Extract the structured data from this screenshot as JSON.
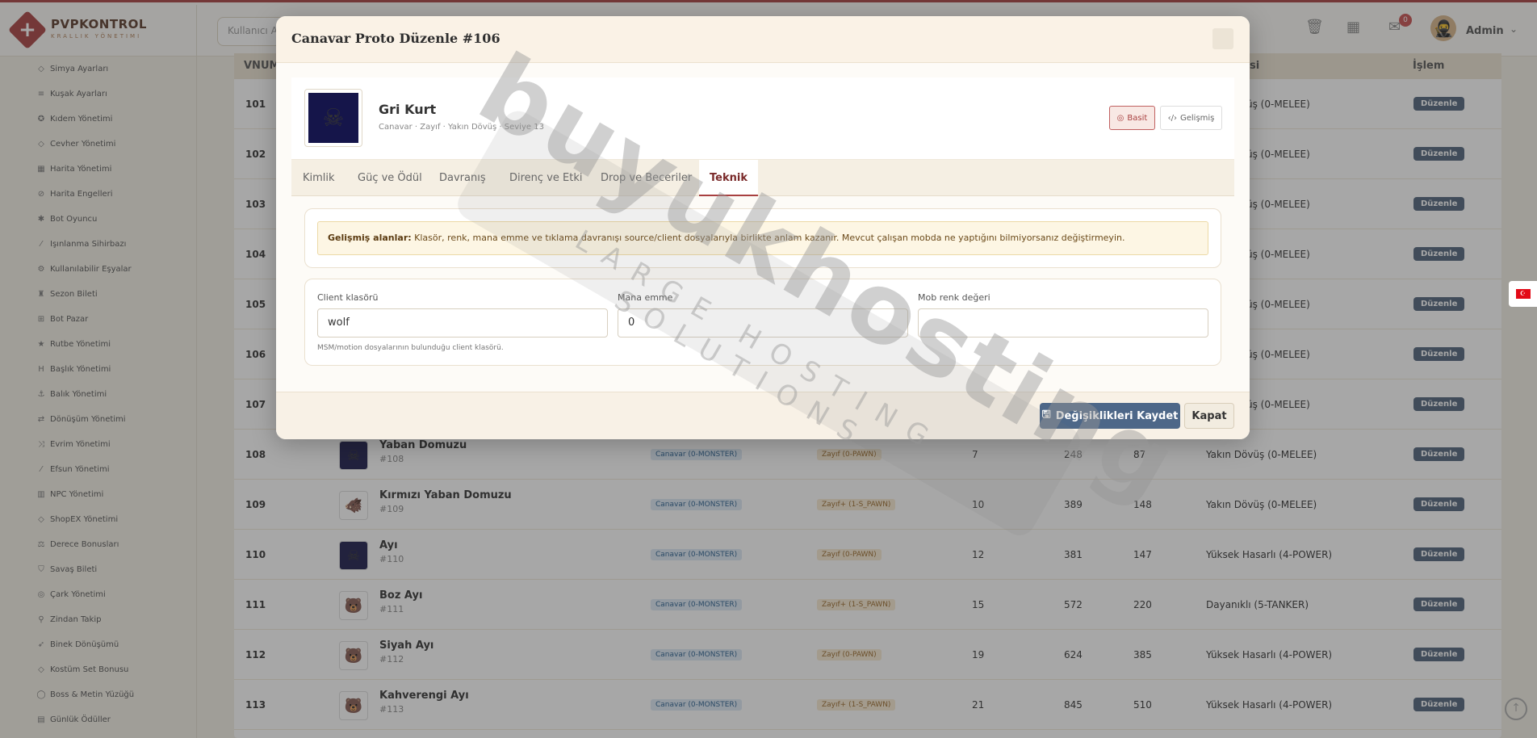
{
  "app": {
    "brand": "PVPKONTROL",
    "brand_sub": "KRALLIK YÖNETIMI",
    "search_placeholder": "Kullanıcı Ad",
    "notif_count": "0",
    "admin_name": "Admin"
  },
  "sidebar": {
    "items": [
      {
        "label": "Simya Ayarları",
        "icon": "gem-icon",
        "glyph": "◇"
      },
      {
        "label": "Kuşak Ayarları",
        "icon": "sliders-icon",
        "glyph": "≡"
      },
      {
        "label": "Kıdem Yönetimi",
        "icon": "medal-icon",
        "glyph": "✪"
      },
      {
        "label": "Cevher Yönetimi",
        "icon": "gem-icon",
        "glyph": "◇"
      },
      {
        "label": "Harita Yönetimi",
        "icon": "map-icon",
        "glyph": "▦"
      },
      {
        "label": "Harita Engelleri",
        "icon": "ban-icon",
        "glyph": "⊘"
      },
      {
        "label": "Bot Oyuncu",
        "icon": "bug-icon",
        "glyph": "✱"
      },
      {
        "label": "Işınlanma Sihirbazı",
        "icon": "wand-icon",
        "glyph": "⁄"
      },
      {
        "label": "Kullanılabilir Eşyalar",
        "icon": "cogs-icon",
        "glyph": "⚙"
      },
      {
        "label": "Sezon Bileti",
        "icon": "trophy-icon",
        "glyph": "♜"
      },
      {
        "label": "Bot Pazar",
        "icon": "cart-icon",
        "glyph": "⊞"
      },
      {
        "label": "Rutbe Yönetimi",
        "icon": "star-icon",
        "glyph": "★"
      },
      {
        "label": "Başlık Yönetimi",
        "icon": "heading-icon",
        "glyph": "H"
      },
      {
        "label": "Balık Yönetimi",
        "icon": "anchor-icon",
        "glyph": "⚓"
      },
      {
        "label": "Dönüşüm Yönetimi",
        "icon": "shuffle-icon",
        "glyph": "⇄"
      },
      {
        "label": "Evrim Yönetimi",
        "icon": "random-icon",
        "glyph": "⤨"
      },
      {
        "label": "Efsun Yönetimi",
        "icon": "magic-icon",
        "glyph": "⁄"
      },
      {
        "label": "NPC Yönetimi",
        "icon": "building-icon",
        "glyph": "▥"
      },
      {
        "label": "ShopEX Yönetimi",
        "icon": "shop-icon",
        "glyph": "◇"
      },
      {
        "label": "Derece Bonusları",
        "icon": "balance-icon",
        "glyph": "⚖"
      },
      {
        "label": "Savaş Bileti",
        "icon": "shield-icon",
        "glyph": "⛉"
      },
      {
        "label": "Çark Yönetimi",
        "icon": "wheel-icon",
        "glyph": "◎"
      },
      {
        "label": "Zindan Takip",
        "icon": "pin-icon",
        "glyph": "⚲"
      },
      {
        "label": "Binek Dönüşümü",
        "icon": "rocket-icon",
        "glyph": "➶"
      },
      {
        "label": "Kostüm Set Bonusu",
        "icon": "gem-icon",
        "glyph": "◇"
      },
      {
        "label": "Boss & Metin Yüzüğü",
        "icon": "ring-icon",
        "glyph": "◯"
      },
      {
        "label": "Günlük Ödüller",
        "icon": "calendar-icon",
        "glyph": "▤"
      }
    ]
  },
  "table": {
    "headers": {
      "vnum": "VNUM",
      "role": "si",
      "actions": "İşlem"
    },
    "edit_label": "Düzenle",
    "rows": [
      {
        "vnum": "101",
        "role": "üş (0-MELEE)"
      },
      {
        "vnum": "102",
        "role": "üş (0-MELEE)"
      },
      {
        "vnum": "103",
        "role": "üş (0-MELEE)"
      },
      {
        "vnum": "104",
        "role": "üş (0-MELEE)"
      },
      {
        "vnum": "105",
        "role": "üş (0-MELEE)"
      },
      {
        "vnum": "106",
        "role": "üş (0-MELEE)"
      },
      {
        "vnum": "107",
        "role": "üş (0-MELEE)"
      },
      {
        "vnum": "108",
        "name": "Yaban Domuzu",
        "sub": "#108",
        "type": "Canavar (0-MONSTER)",
        "rank": "Zayıf (0-PAWN)",
        "lvl": "7",
        "hp": "248",
        "exp": "87",
        "role": "Yakın Dövüş (0-MELEE)",
        "img": "dark",
        "glyph": "☠"
      },
      {
        "vnum": "109",
        "name": "Kırmızı Yaban Domuzu",
        "sub": "#109",
        "type": "Canavar (0-MONSTER)",
        "rank": "Zayıf+ (1-S_PAWN)",
        "lvl": "10",
        "hp": "389",
        "exp": "148",
        "role": "Yakın Dövüş (0-MELEE)",
        "img": "light",
        "glyph": "🐗"
      },
      {
        "vnum": "110",
        "name": "Ayı",
        "sub": "#110",
        "type": "Canavar (0-MONSTER)",
        "rank": "Zayıf (0-PAWN)",
        "lvl": "12",
        "hp": "381",
        "exp": "147",
        "role": "Yüksek Hasarlı (4-POWER)",
        "img": "dark",
        "glyph": "☠"
      },
      {
        "vnum": "111",
        "name": "Boz Ayı",
        "sub": "#111",
        "type": "Canavar (0-MONSTER)",
        "rank": "Zayıf+ (1-S_PAWN)",
        "lvl": "15",
        "hp": "572",
        "exp": "220",
        "role": "Dayanıklı (5-TANKER)",
        "img": "light",
        "glyph": "🐻"
      },
      {
        "vnum": "112",
        "name": "Siyah Ayı",
        "sub": "#112",
        "type": "Canavar (0-MONSTER)",
        "rank": "Zayıf (0-PAWN)",
        "lvl": "19",
        "hp": "624",
        "exp": "385",
        "role": "Yüksek Hasarlı (4-POWER)",
        "img": "light",
        "glyph": "🐻"
      },
      {
        "vnum": "113",
        "name": "Kahverengi Ayı",
        "sub": "#113",
        "type": "Canavar (0-MONSTER)",
        "rank": "Zayıf+ (1-S_PAWN)",
        "lvl": "21",
        "hp": "845",
        "exp": "510",
        "role": "Yüksek Hasarlı (4-POWER)",
        "img": "light",
        "glyph": "🐻"
      }
    ]
  },
  "modal": {
    "title": "Canavar Proto Düzenle #106",
    "mob_name": "Gri Kurt",
    "mob_meta": "Canavar · Zayıf · Yakın Dövüş · Seviye 13",
    "mode_basic": "Basit",
    "mode_advanced": "Gelişmiş",
    "tabs": [
      "Kimlik",
      "Güç ve Ödül",
      "Davranış",
      "Direnç ve Etki",
      "Drop ve Beceriler",
      "Teknik"
    ],
    "warning_bold": "Gelişmiş alanlar:",
    "warning_text": " Klasör, renk, mana emme ve tıklama davranışı source/client dosyalarıyla birlikte anlam kazanır. Mevcut çalışan mobda ne yaptığını bilmiyorsanız değiştirmeyin.",
    "fields": {
      "client_folder_label": "Client klasörü",
      "client_folder_value": "wolf",
      "client_folder_help": "MSM/motion dosyalarının bulunduğu client klasörü.",
      "mana_label": "Mana emme",
      "mana_value": "0",
      "color_label": "Mob renk değeri",
      "color_value": ""
    },
    "save_label": "Değişiklikleri Kaydet",
    "close_label": "Kapat"
  },
  "watermark": {
    "main": "buyukhosting",
    "sub": "LARGE HOSTING SOLUTIONS"
  },
  "colors": {
    "accent": "#a84040",
    "primary_button": "#4d6788",
    "edit_button": "#50637a"
  }
}
